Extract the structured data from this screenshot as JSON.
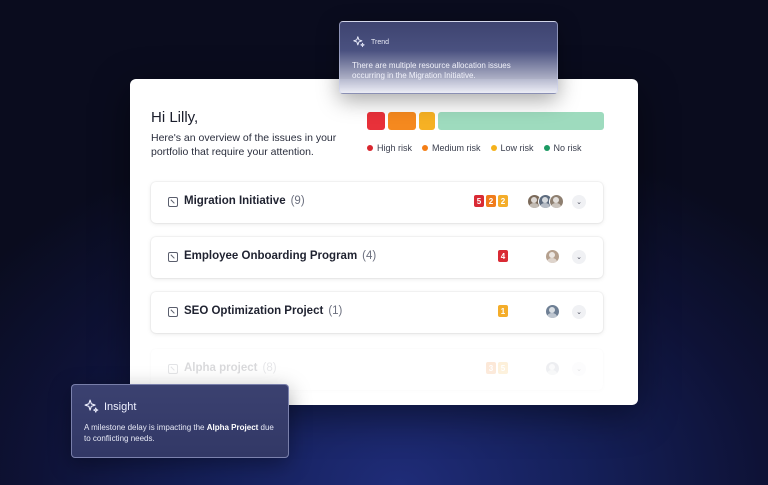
{
  "overview": {
    "greeting": "Hi Lilly,",
    "subtitle": "Here's an overview of the issues in your portfolio that require your attention.",
    "risk_bar": [
      {
        "label": "High risk",
        "fraction": 0.09,
        "color": "#e8313a"
      },
      {
        "label": "Medium risk",
        "fraction": 0.13,
        "color": "#f5891f"
      },
      {
        "label": "Low risk",
        "fraction": 0.08,
        "color": "#f6b124"
      },
      {
        "label": "No risk",
        "fraction": 0.7,
        "color": "#9edbbe"
      }
    ],
    "legend": [
      {
        "label": "High risk",
        "color": "#d9262e"
      },
      {
        "label": "Medium risk",
        "color": "#f47e16"
      },
      {
        "label": "Low risk",
        "color": "#f5b21c"
      },
      {
        "label": "No risk",
        "color": "#1c9a63"
      }
    ]
  },
  "projects": [
    {
      "name": "Migration Initiative",
      "count": "(9)",
      "badges": [
        {
          "value": "5",
          "color": "#d92a34"
        },
        {
          "value": "2",
          "color": "#f07c1c"
        },
        {
          "value": "2",
          "color": "#f4ad2a"
        }
      ],
      "avatars": 3,
      "chevron": "⌄"
    },
    {
      "name": "Employee Onboarding Program",
      "count": "(4)",
      "badges": [
        {
          "value": "4",
          "color": "#d92a34"
        }
      ],
      "avatars": 1,
      "chevron": "⌄"
    },
    {
      "name": "SEO Optimization Project",
      "count": "(1)",
      "badges": [
        {
          "value": "1",
          "color": "#f4ad2a"
        }
      ],
      "avatars": 1,
      "chevron": "⌄"
    },
    {
      "name": "Alpha project",
      "count": "(8)",
      "badges": [
        {
          "value": "3",
          "color": "#f07c1c"
        },
        {
          "value": "5",
          "color": "#f4ad2a"
        }
      ],
      "avatars": 1,
      "chevron": "⌄"
    }
  ],
  "trend_popup": {
    "title": "Trend",
    "text": "There are multiple resource allocation issues occurring in the Migration Initiative.",
    "icon": "sparkle-icon"
  },
  "insight_popup": {
    "title": "Insight",
    "text_before": "A milestone delay is impacting the ",
    "text_bold": "Alpha Project",
    "text_after": " due to conflicting needs.",
    "icon": "sparkle-icon"
  }
}
